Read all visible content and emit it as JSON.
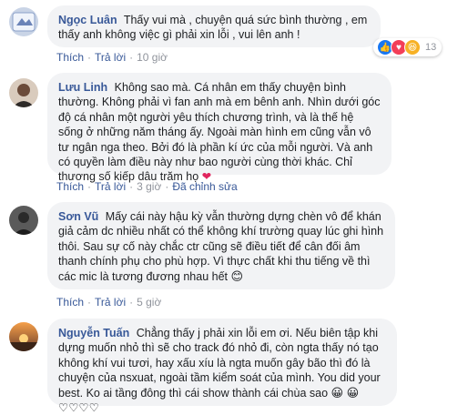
{
  "comments": [
    {
      "name": "Ngọc Luân",
      "text": "Thấy vui mà , chuyện quá sức bình thường , em thấy anh không việc gì phải xin lỗi , vui lên anh !",
      "actions": {
        "like": "Thích",
        "reply": "Trả lời",
        "time": "10 giờ"
      },
      "reaction_count": "13"
    },
    {
      "name": "Lưu Linh",
      "text": "Không sao mà. Cá nhân em thấy chuyện bình thường. Không phải vì fan anh mà em bênh anh. Nhìn dưới góc độ cá nhân một người yêu thích chương trình, và là thế hệ sống ở những năm tháng ấy. Ngoài màn hình em cũng vẫn vô tư ngân nga theo. Bởi đó là phần kí ức của mỗi người. Và anh có quyền làm điều này như bao người cùng thời khác. Chỉ thương số kiếp dâu trăm họ",
      "actions": {
        "like": "Thích",
        "reply": "Trả lời",
        "time": "3 giờ",
        "edited": "Đã chỉnh sửa"
      }
    },
    {
      "name": "Sơn Vũ",
      "text": "Mấy cái này hậu kỳ vẫn thường dựng chèn vô để khán giả cảm dc nhiều nhất có thể không khí trường quay lúc ghi hình thôi. Sau sự cố này chắc ctr cũng sẽ điều tiết để cân đối âm thanh chính phụ cho phù hợp. Vì thực chất khi thu tiếng về thì các mic là tương đương nhau hết",
      "actions": {
        "like": "Thích",
        "reply": "Trả lời",
        "time": "5 giờ"
      }
    },
    {
      "name": "Nguyễn Tuấn",
      "text": "Chẳng thấy j phải xin lỗi em ơi. Nếu biên tập khi dựng muốn nhỏ thì sẽ cho track đó nhỏ đi, còn ngta thấy nó tạo không khí vui tươi, hay xấu xíu là ngta muốn gây bão thì đó là chuyện của nsxuat, ngoài tầm kiểm soát của mình. You did your best. Ko ai tầng đông thì cái show thành cái chùa sao",
      "hearts": "♡♡♡♡"
    }
  ]
}
